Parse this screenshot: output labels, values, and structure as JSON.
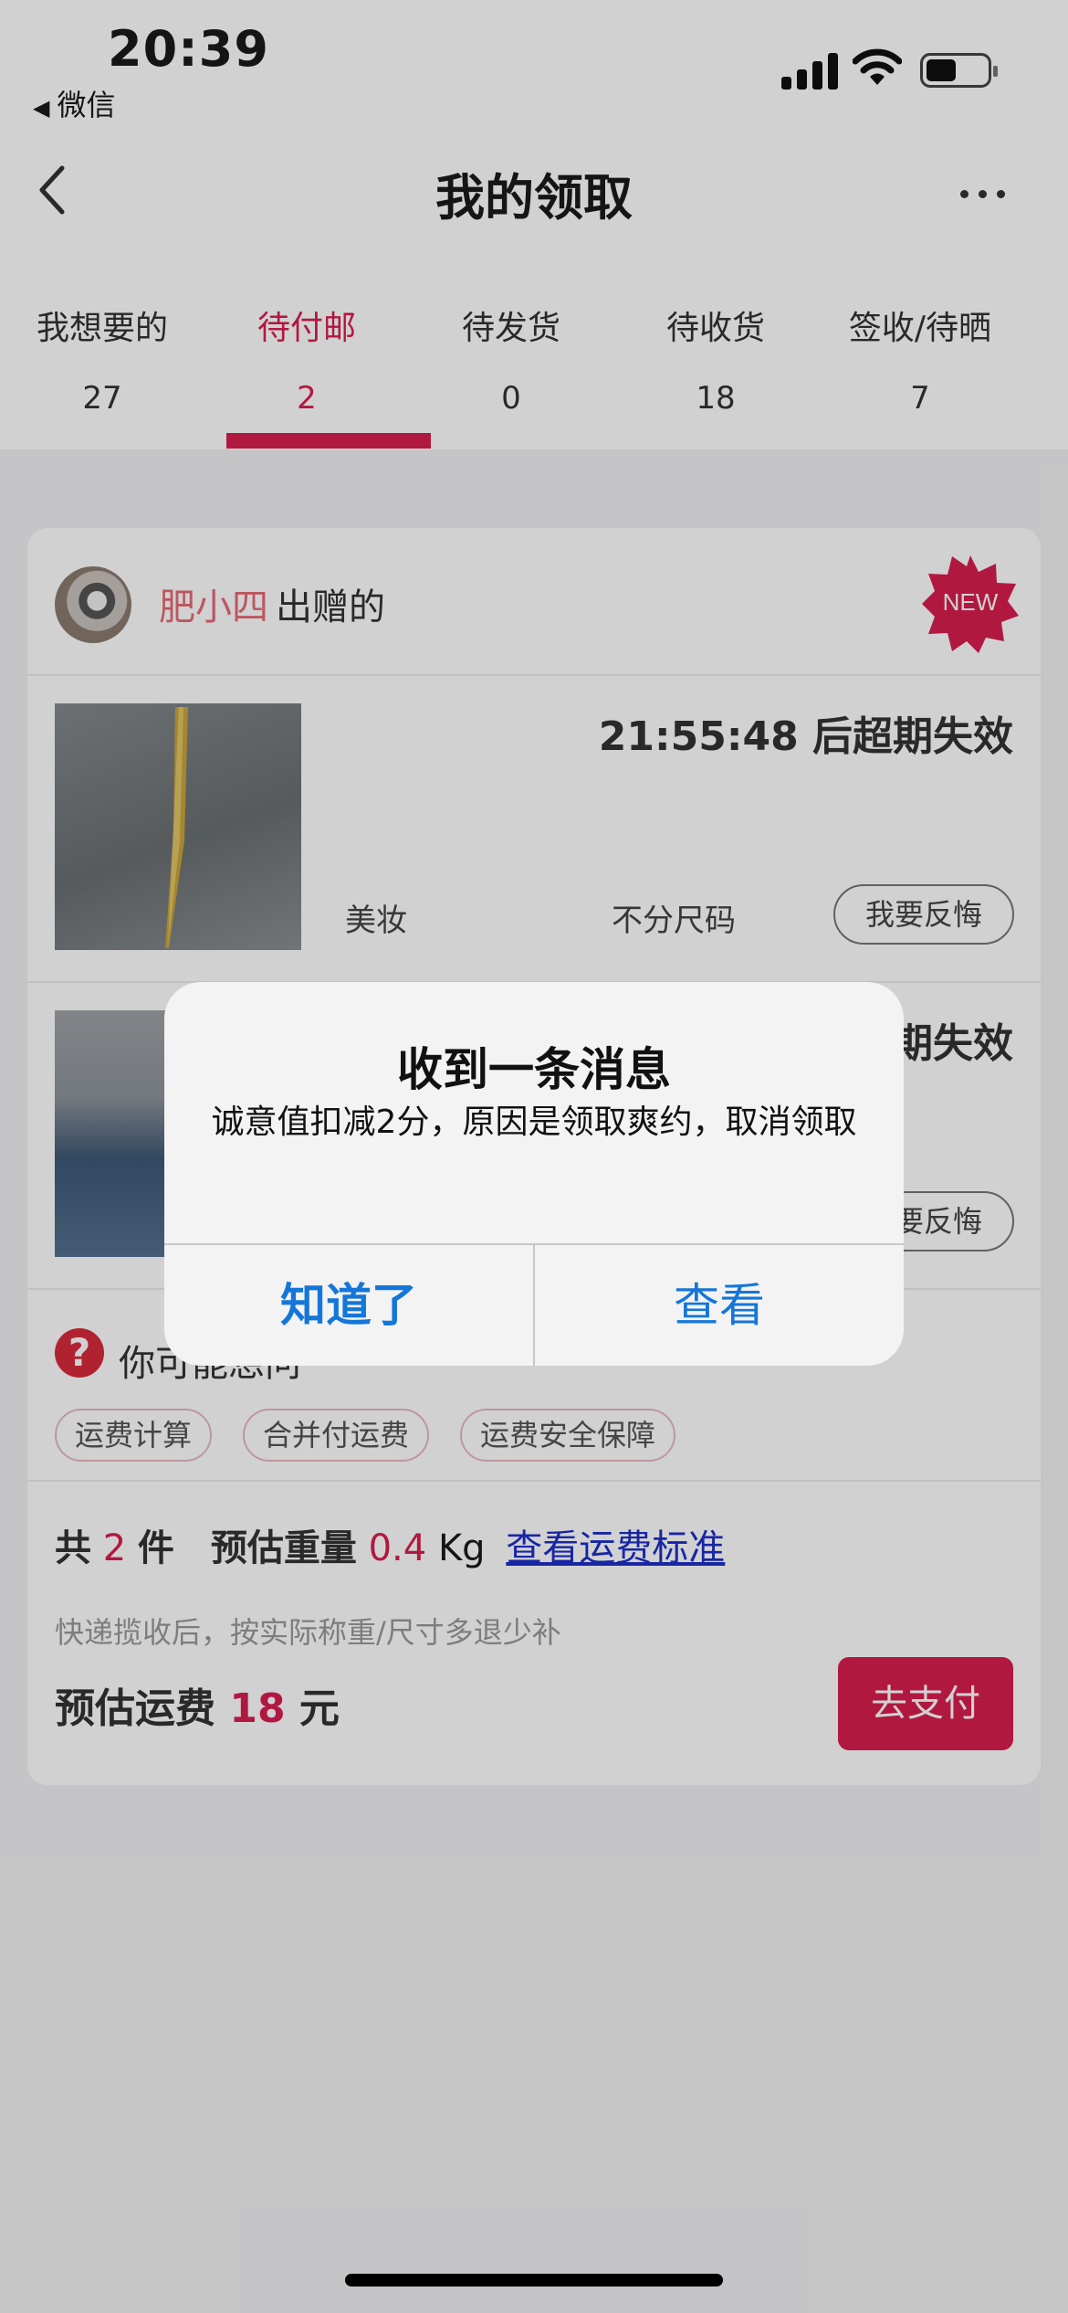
{
  "status_bar": {
    "time": "20:39",
    "back_app": "微信",
    "icons": [
      "signal-icon",
      "wifi-icon",
      "battery-icon"
    ]
  },
  "nav": {
    "title": "我的领取",
    "back_icon": "chevron-left-icon",
    "more_icon": "more-icon"
  },
  "tabs": [
    {
      "label": "我想要的",
      "count": "27"
    },
    {
      "label": "待付邮",
      "count": "2",
      "active": true
    },
    {
      "label": "待发货",
      "count": "0"
    },
    {
      "label": "待收货",
      "count": "18"
    },
    {
      "label": "签收/待晒",
      "count": "7"
    }
  ],
  "card": {
    "giver_name": "肥小四",
    "giver_suffix": "出赠的",
    "badge": "NEW",
    "items": [
      {
        "countdown": "21:55:48 后超期失效",
        "category": "美妆",
        "size": "不分尺码",
        "action": "我要反悔"
      },
      {
        "countdown": "后超期失效",
        "category": "",
        "size": "",
        "action": "我要反悔"
      }
    ],
    "faq": {
      "title": "你可能想问",
      "chips": [
        "运费计算",
        "合并付运费",
        "运费安全保障"
      ]
    },
    "summary": {
      "count_prefix": "共",
      "count": "2",
      "count_suffix": "件",
      "weight_label": "预估重量",
      "weight_value": "0.4",
      "weight_unit": "Kg",
      "fee_link": "查看运费标准",
      "note": "快递揽收后，按实际称重/尺寸多退少补",
      "fee_label": "预估运费",
      "fee_value": "18",
      "fee_unit": "元",
      "pay_button": "去支付"
    }
  },
  "alert": {
    "title": "收到一条消息",
    "message": "诚意值扣减2分，原因是领取爽约，取消领取",
    "ok_button": "知道了",
    "view_button": "查看"
  },
  "colors": {
    "accent": "#d81e4f",
    "link": "#1e2fc9",
    "alert_button": "#1476d8"
  }
}
